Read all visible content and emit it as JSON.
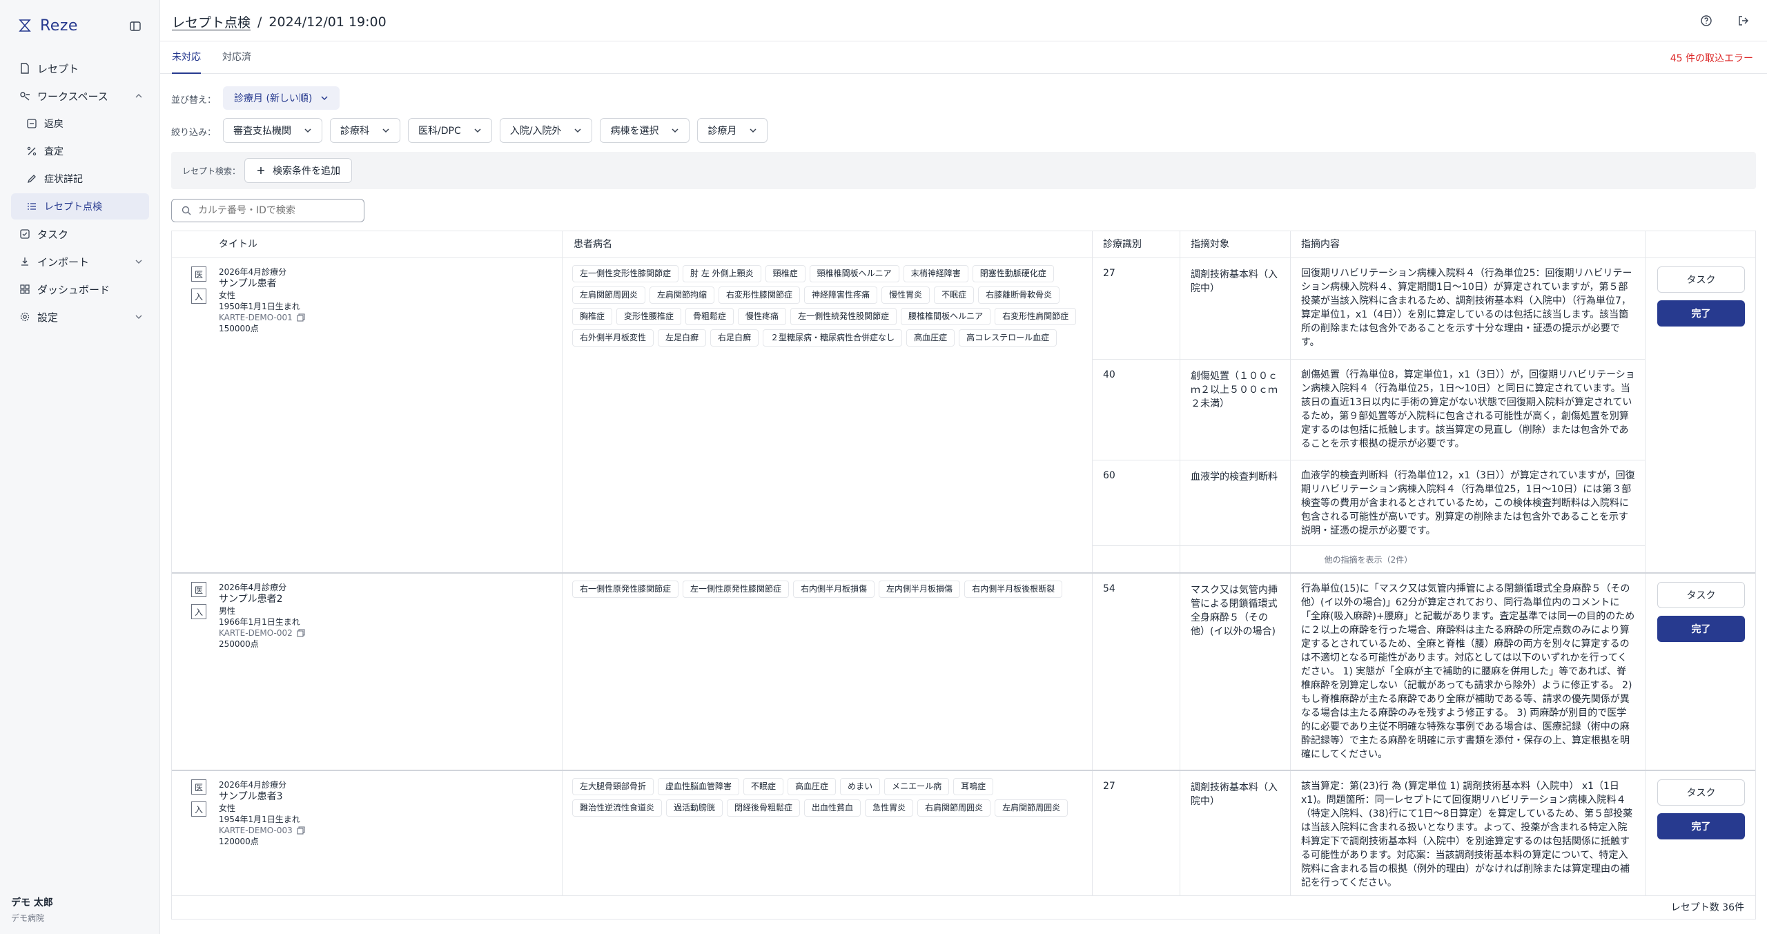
{
  "app": {
    "name": "Reze",
    "accent": "#273a8f",
    "error_color": "#dc2626"
  },
  "sidebar": {
    "items": [
      {
        "label": "レセプト",
        "icon": "document-icon"
      },
      {
        "label": "ワークスペース",
        "icon": "workspace-icon"
      },
      {
        "label": "返戻",
        "icon": "return-icon"
      },
      {
        "label": "査定",
        "icon": "assessment-icon"
      },
      {
        "label": "症状詳記",
        "icon": "pen-icon"
      },
      {
        "label": "レセプト点検",
        "icon": "checklist-icon"
      },
      {
        "label": "タスク",
        "icon": "task-icon"
      },
      {
        "label": "インポート",
        "icon": "import-icon"
      },
      {
        "label": "ダッシュボード",
        "icon": "dashboard-icon"
      },
      {
        "label": "設定",
        "icon": "gear-icon"
      }
    ],
    "user": {
      "name": "デモ 太郎",
      "org": "デモ病院"
    }
  },
  "header": {
    "breadcrumb_link": "レセプト点検",
    "separator": "/",
    "timestamp": "2024/12/01 19:00"
  },
  "tabs": [
    {
      "label": "未対応"
    },
    {
      "label": "対応済"
    }
  ],
  "import_error": "45 件の取込エラー",
  "sort": {
    "label": "並び替え：",
    "value": "診療月 (新しい順)"
  },
  "filter": {
    "label": "絞り込み：",
    "buttons": [
      "審査支払機関",
      "診療科",
      "医科/DPC",
      "入院/入院外",
      "病棟を選択",
      "診療月"
    ]
  },
  "search": {
    "label": "レセプト検索：",
    "add_condition": "検索条件を追加",
    "placeholder": "カルテ番号・IDで検索"
  },
  "table": {
    "headers": [
      "タイトル",
      "患者病名",
      "診療識別",
      "指摘対象",
      "指摘内容"
    ],
    "task_label": "タスク",
    "done_label": "完了",
    "records": [
      {
        "badges": [
          "医",
          "入"
        ],
        "month": "2026年4月診療分",
        "name": "サンプル患者",
        "sex": "女性",
        "birth": "1950年1月1日生まれ",
        "karte": "KARTE-DEMO-001",
        "points": "150000点",
        "diseases": [
          "左一側性変形性膝関節症",
          "肘 左 外側上顆炎",
          "頸椎症",
          "頸椎椎間板ヘルニア",
          "末梢神経障害",
          "閉塞性動脈硬化症",
          "左肩関節周囲炎",
          "左肩関節拘縮",
          "右変形性膝関節症",
          "神経障害性疼痛",
          "慢性胃炎",
          "不眠症",
          "右膝離断骨軟骨炎",
          "胸椎症",
          "変形性腰椎症",
          "骨粗鬆症",
          "慢性疼痛",
          "左一側性続発性股関節症",
          "腰椎椎間板ヘルニア",
          "右変形性肩関節症",
          "右外側半月板変性",
          "左足白癬",
          "右足白癬",
          "２型糖尿病・糖尿病性合併症なし",
          "高血圧症",
          "高コレステロール血症"
        ],
        "issues": [
          {
            "code": "27",
            "target": "調剤技術基本料（入院中）",
            "content": "回復期リハビリテーション病棟入院料４（行為単位25：回復期リハビリテーション病棟入院料４、算定期間1日〜10日）が算定されていますが，第５部投薬が当該入院料に含まれるため、調剤技術基本料（入院中）（行為単位7，算定単位1，x1（4日））を別に算定しているのは包括に該当します。該当箇所の削除または包含外であることを示す十分な理由・証憑の提示が必要です。"
          },
          {
            "code": "40",
            "target": "創傷処置（１００ｃｍ２以上５００ｃｍ２未満）",
            "content": "創傷処置（行為単位8，算定単位1，x1（3日））が，回復期リハビリテーション病棟入院料４（行為単位25，1日〜10日）と同日に算定されています。当該日の直近13日以内に手術の算定がない状態で回復期入院料が算定されているため，第９部処置等が入院料に包含される可能性が高く，創傷処置を別算定するのは包括に抵触します。該当算定の見直し（削除）または包含外であることを示す根拠の提示が必要です。"
          },
          {
            "code": "60",
            "target": "血液学的検査判断料",
            "content": "血液学的検査判断料（行為単位12，x1（3日））が算定されていますが，回復期リハビリテーション病棟入院料４（行為単位25，1日〜10日）には第３部検査等の費用が含まれるとされているため，この検体検査判断料は入院料に包含される可能性が高いです。別算定の削除または包含外であることを示す説明・証憑の提示が必要です。"
          }
        ],
        "more": "他の指摘を表示（2件）"
      },
      {
        "badges": [
          "医",
          "入"
        ],
        "month": "2026年4月診療分",
        "name": "サンプル患者2",
        "sex": "男性",
        "birth": "1966年1月1日生まれ",
        "karte": "KARTE-DEMO-002",
        "points": "250000点",
        "diseases": [
          "右一側性原発性膝関節症",
          "左一側性原発性膝関節症",
          "右内側半月板損傷",
          "左内側半月板損傷",
          "右内側半月板後根断裂"
        ],
        "issues": [
          {
            "code": "54",
            "target": "マスク又は気管内挿管による閉鎖循環式全身麻酔５（その他）(イ以外の場合)",
            "content": "行為単位(15)に「マスク又は気管内挿管による閉鎖循環式全身麻酔５（その他）(イ以外の場合)」62分が算定されており、同行為単位内のコメントに「全麻(吸入麻酔)+腰麻」と記載があります。査定基準では同一の目的のために２以上の麻酔を行った場合、麻酔料は主たる麻酔の所定点数のみにより算定するとされているため、全麻と脊椎（腰）麻酔の両方を別々に算定するのは不適切となる可能性があります。対応としては以下のいずれかを行ってください。 1) 実態が「全麻が主で補助的に腰麻を併用した」等であれば、脊椎麻酔を別算定しない（記載があっても請求から除外）ように修正する。 2) もし脊椎麻酔が主たる麻酔であり全麻が補助である等、請求の優先関係が異なる場合は主たる麻酔のみを残すよう修正する。 3) 両麻酔が別目的で医学的に必要であり主従不明確な特殊な事例である場合は、医療記録（術中の麻酔記録等）で主たる麻酔を明確に示す書類を添付・保存の上、算定根拠を明確にしてください。"
          }
        ]
      },
      {
        "badges": [
          "医",
          "入"
        ],
        "month": "2026年4月診療分",
        "name": "サンプル患者3",
        "sex": "女性",
        "birth": "1954年1月1日生まれ",
        "karte": "KARTE-DEMO-003",
        "points": "120000点",
        "diseases": [
          "左大腿骨頸部骨折",
          "虚血性脳血管障害",
          "不眠症",
          "高血圧症",
          "めまい",
          "メニエール病",
          "耳鳴症",
          "難治性逆流性食道炎",
          "過活動膀胱",
          "閉経後骨粗鬆症",
          "出血性貧血",
          "急性胃炎",
          "右肩関節周囲炎",
          "左肩関節周囲炎"
        ],
        "issues": [
          {
            "code": "27",
            "target": "調剤技術基本料（入院中）",
            "content": "該当算定：第(23)行 為 (算定単位 1) 調剤技術基本料（入院中） x1（1日 x1)。問題箇所：同一レセプトにて回復期リハビリテーション病棟入院料４（特定入院料、(38)行にて1日〜8日算定）を算定しているため、第５部投薬は当該入院料に含まれる扱いとなります。よって、投薬が含まれる特定入院料算定下で調剤技術基本料（入院中）を別途算定するのは包括関係に抵触する可能性があります。対応案：当該調剤技術基本料の算定について、特定入院料に含まれる旨の根拠（例外的理由）がなければ削除または算定理由の補記を行ってください。"
          }
        ]
      }
    ]
  },
  "footer": {
    "count": "レセプト数 36件"
  }
}
